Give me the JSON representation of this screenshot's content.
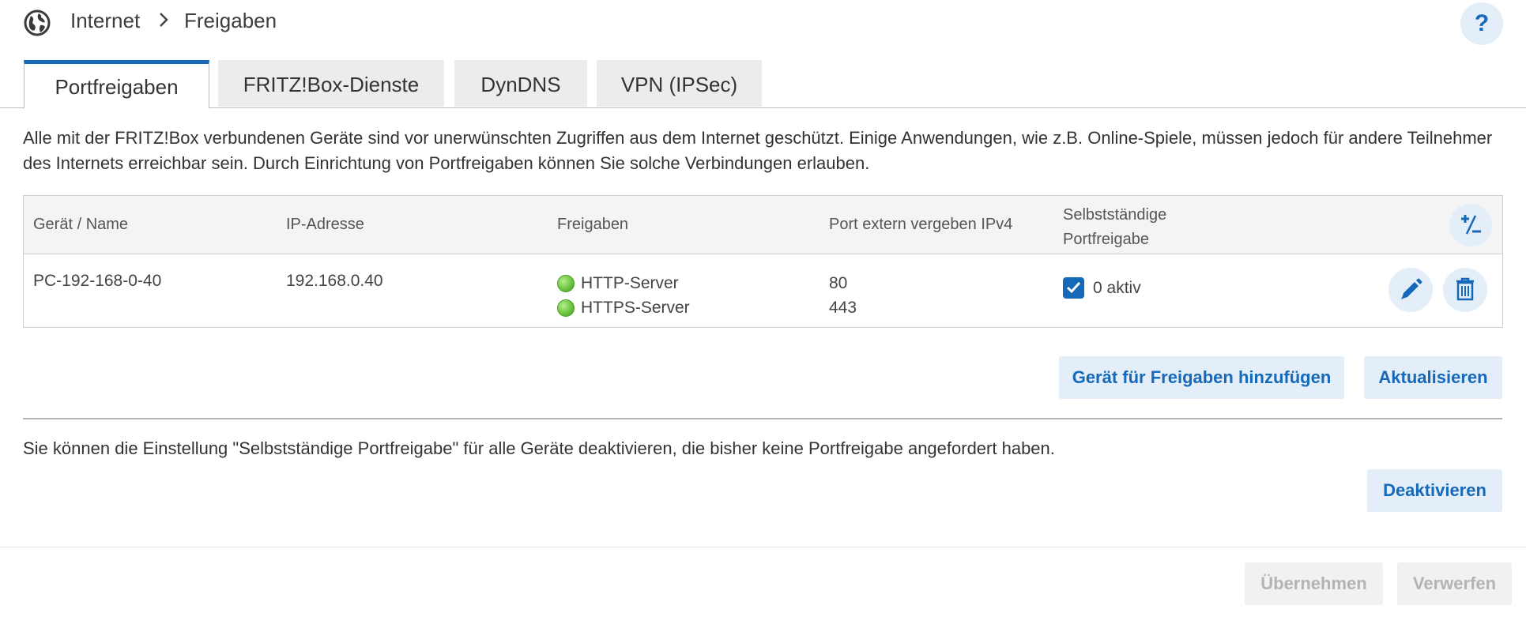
{
  "breadcrumb": {
    "root": "Internet",
    "current": "Freigaben"
  },
  "help": {
    "label": "?"
  },
  "tabs": [
    {
      "label": "Portfreigaben",
      "active": true
    },
    {
      "label": "FRITZ!Box-Dienste",
      "active": false
    },
    {
      "label": "DynDNS",
      "active": false
    },
    {
      "label": "VPN (IPSec)",
      "active": false
    }
  ],
  "intro": "Alle mit der FRITZ!Box verbundenen Geräte sind vor unerwünschten Zugriffen aus dem Internet geschützt. Einige Anwendungen, wie z.B. Online-Spiele, müssen jedoch für andere Teilnehmer des Internets erreichbar sein. Durch Einrichtung von Portfreigaben können Sie solche Verbindungen erlauben.",
  "table": {
    "headers": {
      "device": "Gerät / Name",
      "ip": "IP-Adresse",
      "shares": "Freigaben",
      "port": "Port extern vergeben IPv4",
      "auto_line1": "Selbstständige",
      "auto_line2": "Portfreigabe"
    },
    "rows": [
      {
        "device": "PC-192-168-0-40",
        "ip": "192.168.0.40",
        "shares": [
          "HTTP-Server",
          "HTTPS-Server"
        ],
        "ports": [
          "80",
          "443"
        ],
        "auto_checked": true,
        "auto_label": "0 aktiv"
      }
    ]
  },
  "buttons": {
    "add_device": "Gerät für Freigaben hinzufügen",
    "refresh": "Aktualisieren",
    "deactivate": "Deaktivieren",
    "apply": "Übernehmen",
    "discard": "Verwerfen"
  },
  "note": "Sie können die Einstellung \"Selbstständige Portfreigabe\" für alle Geräte deaktivieren, die bisher keine Portfreigabe angefordert haben.",
  "colors": {
    "accent": "#1569b8",
    "button_bg": "#e3eef8",
    "status_green": "#6cc540"
  },
  "icons": {
    "globe": "globe-icon",
    "chevron": "chevron-right-icon",
    "plus_minus": "plus-minus-icon",
    "edit": "pencil-icon",
    "delete": "trash-icon",
    "check": "check-icon"
  }
}
